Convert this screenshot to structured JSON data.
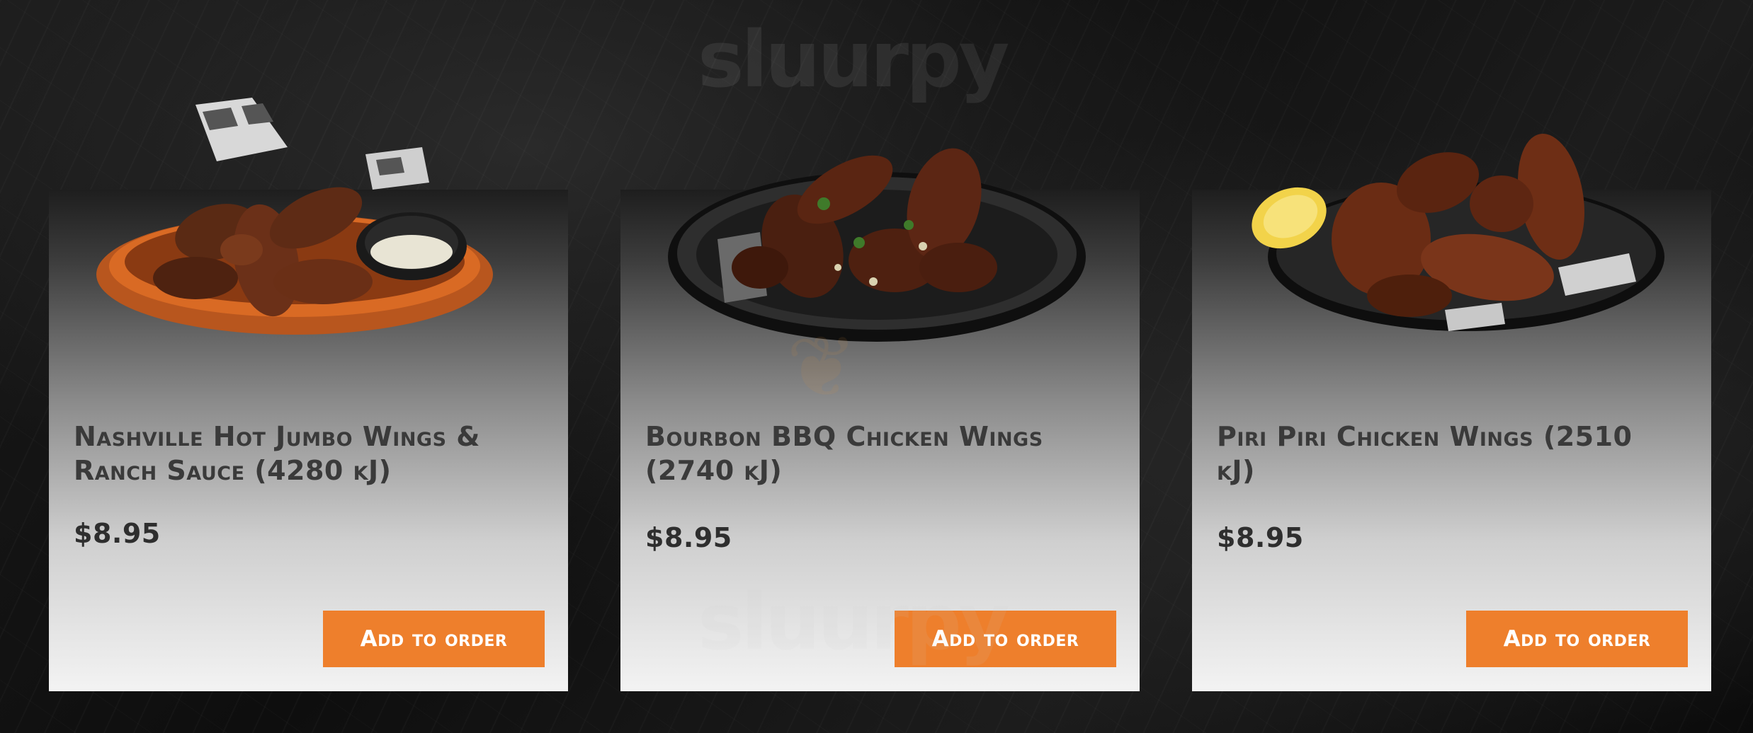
{
  "watermark": {
    "text": "sluurpy"
  },
  "products": [
    {
      "name": "Nashville Hot Jumbo Wings & Ranch Sauce (4280 kJ)",
      "price": "$8.95",
      "button_label": "Add to order",
      "image_icon": "wings-basket-image"
    },
    {
      "name": "Bourbon BBQ Chicken Wings (2740 kJ)",
      "price": "$8.95",
      "button_label": "Add to order",
      "image_icon": "wings-plate-image"
    },
    {
      "name": "Piri Piri Chicken Wings (2510 kJ)",
      "price": "$8.95",
      "button_label": "Add to order",
      "image_icon": "wings-plate-lemon-image"
    }
  ],
  "colors": {
    "accent": "#ee7f2c",
    "title_text": "#3a3a3a",
    "background": "#141414"
  }
}
